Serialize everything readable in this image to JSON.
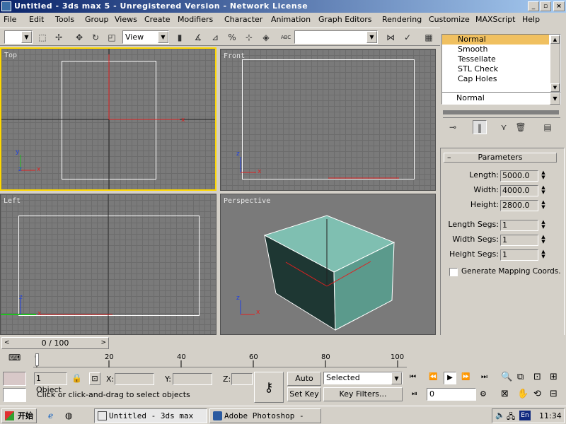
{
  "window": {
    "title": "Untitled - 3ds max 5 - Unregistered Version - Network License",
    "min_label": "_",
    "max_label": "▫",
    "close_label": "×"
  },
  "menu": [
    "File",
    "Edit",
    "Tools",
    "Group",
    "Views",
    "Create",
    "Modifiers",
    "Character",
    "Animation",
    "Graph Editors",
    "Rendering",
    "Customize",
    "MAXScript",
    "Help"
  ],
  "toolbar": {
    "ref_coord": "View",
    "named_sel": "",
    "abc_label": "ABC"
  },
  "viewports": {
    "top": "Top",
    "front": "Front",
    "left": "Left",
    "perspective": "Perspective",
    "axis_x": "x",
    "axis_y": "y",
    "axis_z": "z"
  },
  "dropdown": {
    "options": [
      "Normal",
      "Smooth",
      "Tessellate",
      "STL Check",
      "Cap Holes"
    ],
    "selected": "Normal",
    "closed_value": "Normal"
  },
  "params": {
    "rollout_title": "Parameters",
    "length_label": "Length:",
    "length": "5000.0",
    "width_label": "Width:",
    "width": "4000.0",
    "height_label": "Height:",
    "height": "2800.0",
    "lsegs_label": "Length Segs:",
    "lsegs": "1",
    "wsegs_label": "Width Segs:",
    "wsegs": "1",
    "hsegs_label": "Height Segs:",
    "hsegs": "1",
    "gen_map_label": "Generate Mapping Coords."
  },
  "timeline": {
    "frame": "0 / 100",
    "ticks": [
      "0",
      "20",
      "40",
      "60",
      "80",
      "100"
    ]
  },
  "status": {
    "selection": "1 Object",
    "x_label": "X:",
    "y_label": "Y:",
    "z_label": "Z:",
    "auto_key": "Auto Key",
    "set_key": "Set Key",
    "key_mode": "Selected",
    "key_filters": "Key Filters...",
    "frame_value": "0",
    "prompt": "Click or click-and-drag to select objects"
  },
  "taskbar": {
    "start": "开始",
    "task1": "Untitled - 3ds max ...",
    "task2": "Adobe Photoshop - [...",
    "lang": "En",
    "clock": "11:34"
  },
  "colors": {
    "box_top": "#7fbfb1",
    "box_front": "#1e3733",
    "box_side": "#5b9a8c",
    "active_border": "#ffd800",
    "axis_red": "#e02020",
    "axis_green": "#20c020",
    "axis_blue": "#2040e0"
  }
}
